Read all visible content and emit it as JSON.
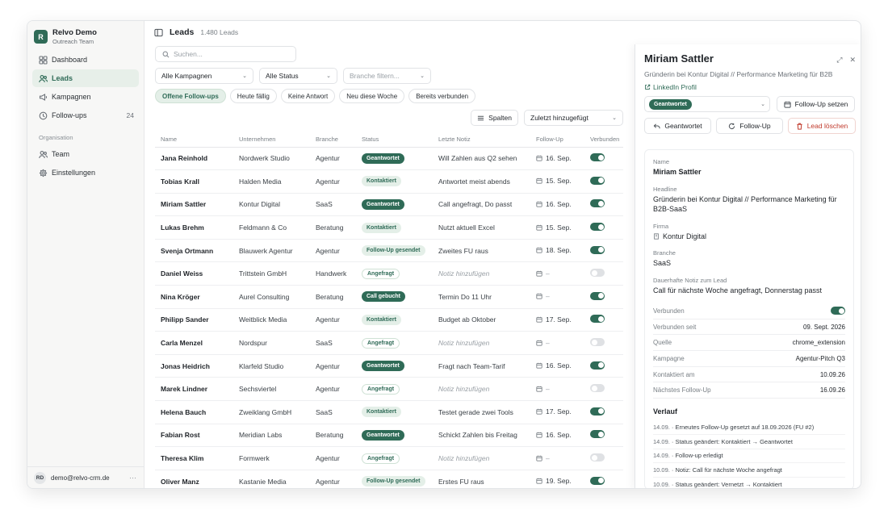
{
  "brand": {
    "logo_letter": "R",
    "name": "Relvo Demo",
    "team": "Outreach Team"
  },
  "nav": [
    {
      "label": "Dashboard",
      "icon": "grid-icon",
      "active": false
    },
    {
      "label": "Leads",
      "icon": "users-icon",
      "active": true
    },
    {
      "label": "Kampagnen",
      "icon": "megaphone-icon",
      "active": false
    },
    {
      "label": "Follow-ups",
      "icon": "clock-icon",
      "active": false,
      "count": "24"
    }
  ],
  "nav_section": "Organisation",
  "nav2": [
    {
      "label": "Team",
      "icon": "users-icon"
    },
    {
      "label": "Einstellungen",
      "icon": "gear-icon"
    }
  ],
  "footer": {
    "initials": "RD",
    "email": "demo@relvo-crm.de",
    "more": "···"
  },
  "page": {
    "title": "Leads",
    "count": "1.480 Leads"
  },
  "search": {
    "placeholder": "Suchen..."
  },
  "filters": [
    {
      "label": "Alle Kampagnen",
      "placeholder": false,
      "width": 122
    },
    {
      "label": "Alle Status",
      "placeholder": false,
      "width": 97
    },
    {
      "label": "Branche filtern...",
      "placeholder": true,
      "width": 109
    }
  ],
  "chips": [
    {
      "label": "Offene Follow-ups",
      "active": true
    },
    {
      "label": "Heute fällig",
      "active": false
    },
    {
      "label": "Keine Antwort",
      "active": false
    },
    {
      "label": "Neu diese Woche",
      "active": false
    },
    {
      "label": "Bereits verbunden",
      "active": false
    }
  ],
  "tools": {
    "columns": "Spalten",
    "sort": "Zuletzt hinzugefügt"
  },
  "columns": [
    "Name",
    "Unternehmen",
    "Branche",
    "Status",
    "Letzte Notiz",
    "Follow-Up",
    "Verbunden"
  ],
  "rows": [
    {
      "name": "Jana Reinhold",
      "company": "Nordwerk Studio",
      "branch": "Agentur",
      "status": "Geantwortet",
      "status_style": "green",
      "note": "Will Zahlen aus Q2 sehen",
      "note_empty": false,
      "followup": "16. Sep.",
      "connected": true
    },
    {
      "name": "Tobias Krall",
      "company": "Halden Media",
      "branch": "Agentur",
      "status": "Kontaktiert",
      "status_style": "light",
      "note": "Antwortet meist abends",
      "note_empty": false,
      "followup": "15. Sep.",
      "connected": true
    },
    {
      "name": "Miriam Sattler",
      "company": "Kontur Digital",
      "branch": "SaaS",
      "status": "Geantwortet",
      "status_style": "green",
      "note": "Call angefragt, Do passt",
      "note_empty": false,
      "followup": "16. Sep.",
      "connected": true
    },
    {
      "name": "Lukas Brehm",
      "company": "Feldmann & Co",
      "branch": "Beratung",
      "status": "Kontaktiert",
      "status_style": "light",
      "note": "Nutzt aktuell Excel",
      "note_empty": false,
      "followup": "15. Sep.",
      "connected": true
    },
    {
      "name": "Svenja Ortmann",
      "company": "Blauwerk Agentur",
      "branch": "Agentur",
      "status": "Follow-Up gesendet",
      "status_style": "light",
      "note": "Zweites FU raus",
      "note_empty": false,
      "followup": "18. Sep.",
      "connected": true
    },
    {
      "name": "Daniel Weiss",
      "company": "Trittstein GmbH",
      "branch": "Handwerk",
      "status": "Angefragt",
      "status_style": "outline",
      "note": "Notiz hinzufügen",
      "note_empty": true,
      "followup": "–",
      "connected": false
    },
    {
      "name": "Nina Kröger",
      "company": "Aurel Consulting",
      "branch": "Beratung",
      "status": "Call gebucht",
      "status_style": "green",
      "note": "Termin Do 11 Uhr",
      "note_empty": false,
      "followup": "–",
      "connected": true
    },
    {
      "name": "Philipp Sander",
      "company": "Weitblick Media",
      "branch": "Agentur",
      "status": "Kontaktiert",
      "status_style": "light",
      "note": "Budget ab Oktober",
      "note_empty": false,
      "followup": "17. Sep.",
      "connected": true
    },
    {
      "name": "Carla Menzel",
      "company": "Nordspur",
      "branch": "SaaS",
      "status": "Angefragt",
      "status_style": "outline",
      "note": "Notiz hinzufügen",
      "note_empty": true,
      "followup": "–",
      "connected": false
    },
    {
      "name": "Jonas Heidrich",
      "company": "Klarfeld Studio",
      "branch": "Agentur",
      "status": "Geantwortet",
      "status_style": "green",
      "note": "Fragt nach Team-Tarif",
      "note_empty": false,
      "followup": "16. Sep.",
      "connected": true
    },
    {
      "name": "Marek Lindner",
      "company": "Sechsviertel",
      "branch": "Agentur",
      "status": "Angefragt",
      "status_style": "outline",
      "note": "Notiz hinzufügen",
      "note_empty": true,
      "followup": "–",
      "connected": false
    },
    {
      "name": "Helena Bauch",
      "company": "Zweiklang GmbH",
      "branch": "SaaS",
      "status": "Kontaktiert",
      "status_style": "light",
      "note": "Testet gerade zwei Tools",
      "note_empty": false,
      "followup": "17. Sep.",
      "connected": true
    },
    {
      "name": "Fabian Rost",
      "company": "Meridian Labs",
      "branch": "Beratung",
      "status": "Geantwortet",
      "status_style": "green",
      "note": "Schickt Zahlen bis Freitag",
      "note_empty": false,
      "followup": "16. Sep.",
      "connected": true
    },
    {
      "name": "Theresa Klim",
      "company": "Formwerk",
      "branch": "Agentur",
      "status": "Angefragt",
      "status_style": "outline",
      "note": "Notiz hinzufügen",
      "note_empty": true,
      "followup": "–",
      "connected": false
    },
    {
      "name": "Oliver Manz",
      "company": "Kastanie Media",
      "branch": "Agentur",
      "status": "Follow-Up gesendet",
      "status_style": "light",
      "note": "Erstes FU raus",
      "note_empty": false,
      "followup": "19. Sep.",
      "connected": true
    }
  ],
  "detail": {
    "name": "Miriam Sattler",
    "headline": "Gründerin bei Kontur Digital // Performance Marketing für B2B",
    "linkedin": "LinkedIn Profil",
    "status_select": "Geantwortet",
    "btn_set_followup": "Follow-Up setzen",
    "btn_answered": "Geantwortet",
    "btn_followup": "Follow-Up",
    "btn_delete": "Lead löschen",
    "fields": {
      "name_label": "Name",
      "name_value": "Miriam Sattler",
      "headline_label": "Headline",
      "headline_value": "Gründerin bei Kontur Digital // Performance Marketing für B2B-SaaS",
      "company_label": "Firma",
      "company_value": "Kontur Digital",
      "branch_label": "Branche",
      "branch_value": "SaaS",
      "note_label": "Dauerhafte Notiz zum Lead",
      "note_value": "Call für nächste Woche angefragt, Donnerstag passt"
    },
    "kv": [
      {
        "k": "Verbunden",
        "v": "",
        "toggle": true
      },
      {
        "k": "Verbunden seit",
        "v": "09. Sept. 2026"
      },
      {
        "k": "Quelle",
        "v": "chrome_extension"
      },
      {
        "k": "Kampagne",
        "v": "Agentur-Pitch Q3"
      },
      {
        "k": "Kontaktiert am",
        "v": "10.09.26"
      },
      {
        "k": "Nächstes Follow-Up",
        "v": "16.09.26"
      }
    ],
    "history_title": "Verlauf",
    "history": [
      {
        "date": "14.09.",
        "text": "· Erneutes Follow-Up gesetzt auf 18.09.2026 (FU #2)"
      },
      {
        "date": "14.09.",
        "text": "· Status geändert: Kontaktiert → Geantwortet"
      },
      {
        "date": "14.09.",
        "text": "· Follow-up erledigt"
      },
      {
        "date": "10.09.",
        "text": "· Notiz: Call für nächste Woche angefragt"
      },
      {
        "date": "10.09.",
        "text": "· Status geändert: Vernetzt → Kontaktiert"
      }
    ]
  },
  "colors": {
    "accent": "#2f6b57",
    "accent_light": "#e4efe8",
    "danger": "#c0392b"
  }
}
